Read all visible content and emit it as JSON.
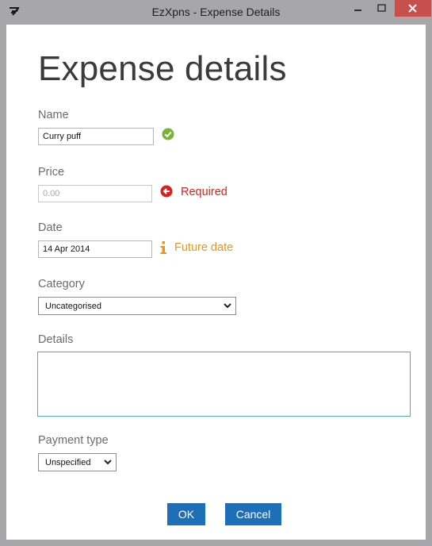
{
  "window": {
    "title": "EzXpns - Expense Details"
  },
  "form": {
    "heading": "Expense details",
    "name": {
      "label": "Name",
      "value": "Curry puff"
    },
    "price": {
      "label": "Price",
      "placeholder": "0.00",
      "message": "Required"
    },
    "date": {
      "label": "Date",
      "value": "14 Apr 2014",
      "message": "Future date"
    },
    "category": {
      "label": "Category",
      "selected": "Uncategorised"
    },
    "details": {
      "label": "Details",
      "value": ""
    },
    "payment_type": {
      "label": "Payment type",
      "selected": "Unspecified"
    }
  },
  "buttons": {
    "ok_label": "OK",
    "cancel_label": "Cancel"
  },
  "colors": {
    "valid": "#7ab23a",
    "error": "#d7231f",
    "warning": "#e9971c",
    "accent": "#1e6fb8"
  },
  "icons": {
    "app": "ezxpns-logo-icon",
    "name_status": "check-circle-icon",
    "price_status": "error-arrow-icon",
    "date_status": "info-icon",
    "dropdown": "chevron-down-icon"
  }
}
